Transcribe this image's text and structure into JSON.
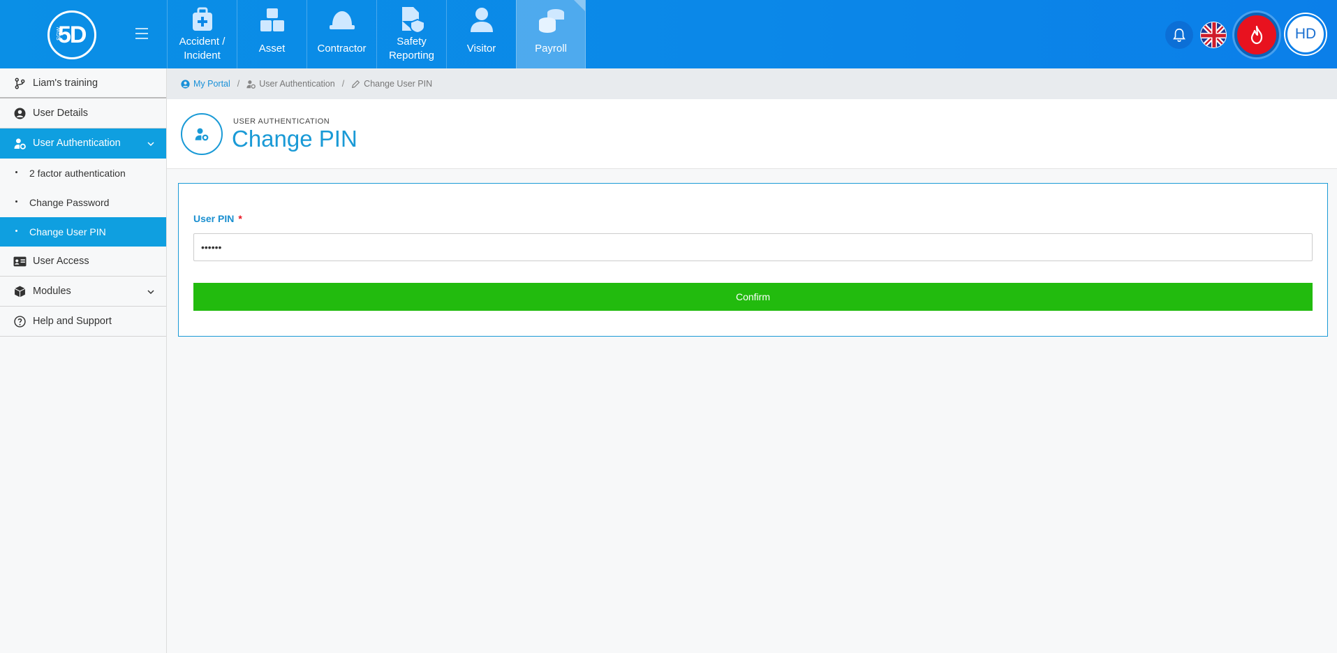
{
  "brand": {
    "logo_text": "5D",
    "logo_small": "SGW"
  },
  "topnav": {
    "modules": [
      {
        "label": "Accident / Incident",
        "icon": "first-aid-kit-icon"
      },
      {
        "label": "Asset",
        "icon": "boxes-icon"
      },
      {
        "label": "Contractor",
        "icon": "hard-hat-icon"
      },
      {
        "label": "Safety Reporting",
        "icon": "shield-document-icon"
      },
      {
        "label": "Visitor",
        "icon": "person-icon"
      },
      {
        "label": "Payroll",
        "icon": "coins-icon",
        "active": true
      }
    ],
    "avatar_initials": "HD"
  },
  "sidebar": {
    "items": [
      {
        "label": "Liam's training",
        "icon": "branch-icon"
      },
      {
        "label": "User Details",
        "icon": "user-circle-icon"
      },
      {
        "label": "User Authentication",
        "icon": "user-cog-icon",
        "active": true
      },
      {
        "label": "User Access",
        "icon": "id-card-icon"
      },
      {
        "label": "Modules",
        "icon": "cube-icon"
      },
      {
        "label": "Help and Support",
        "icon": "question-circle-icon"
      }
    ],
    "subitems": [
      {
        "label": "2 factor authentication"
      },
      {
        "label": "Change Password"
      },
      {
        "label": "Change User PIN",
        "active": true
      }
    ]
  },
  "breadcrumb": {
    "home": "My Portal",
    "section": "User Authentication",
    "current": "Change User PIN"
  },
  "header": {
    "kicker": "USER AUTHENTICATION",
    "title": "Change PIN"
  },
  "form": {
    "pin_label": "User PIN",
    "required_mark": "*",
    "pin_value": "••••••",
    "confirm_label": "Confirm"
  },
  "colors": {
    "topbar": "#0b88e8",
    "accent": "#1a9ad6",
    "active_sidebar": "#0f9fe0",
    "confirm": "#22bb0e",
    "fire": "#e8121f"
  }
}
